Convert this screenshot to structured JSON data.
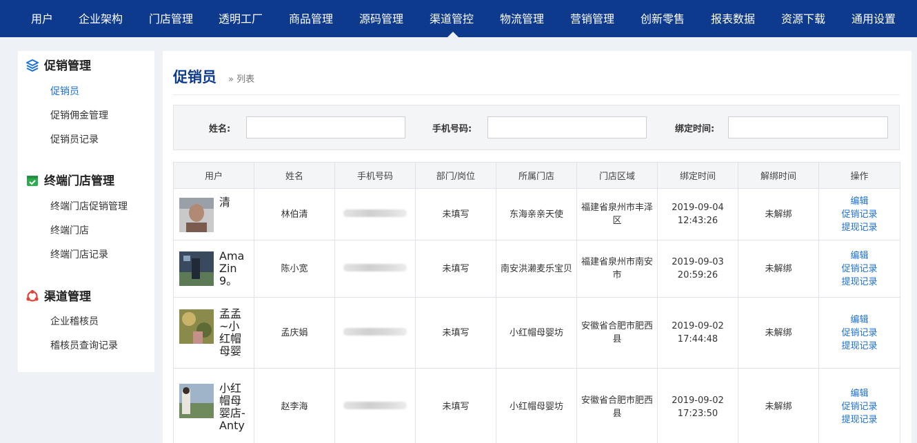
{
  "nav": {
    "items": [
      "用户",
      "企业架构",
      "门店管理",
      "透明工厂",
      "商品管理",
      "源码管理",
      "渠道管控",
      "物流管理",
      "营销管理",
      "创新零售",
      "报表数据",
      "资源下载",
      "通用设置"
    ],
    "active": "渠道管控"
  },
  "sidebar": {
    "sections": [
      {
        "title": "促销管理",
        "icon": "layers-icon",
        "links": [
          "促销员",
          "促销佣金管理",
          "促销员记录"
        ]
      },
      {
        "title": "终端门店管理",
        "icon": "store-icon",
        "links": [
          "终端门店促销管理",
          "终端门店",
          "终端门店记录"
        ]
      },
      {
        "title": "渠道管理",
        "icon": "channel-icon",
        "links": [
          "企业稽核员",
          "稽核员查询记录"
        ]
      }
    ],
    "active_link": "促销员"
  },
  "page": {
    "title": "促销员",
    "crumb": "» 列表"
  },
  "filters": [
    {
      "label": "姓名:",
      "value": ""
    },
    {
      "label": "手机号码:",
      "value": ""
    },
    {
      "label": "绑定时间:",
      "value": ""
    }
  ],
  "table": {
    "headers": [
      "用户",
      "姓名",
      "手机号码",
      "部门/岗位",
      "所属门店",
      "门店区域",
      "绑定时间",
      "解绑时间",
      "操作"
    ],
    "rows": [
      {
        "user": "清",
        "name": "林伯清",
        "dept": "未填写",
        "store": "东海亲亲天使",
        "region": "福建省泉州市丰泽区",
        "bind_time": "2019-09-04 12:43:26",
        "unbind_time": "未解绑"
      },
      {
        "user": "Ama Zin 9。",
        "name": "陈小宽",
        "dept": "未填写",
        "store": "南安洪濑麦乐宝贝",
        "region": "福建省泉州市南安市",
        "bind_time": "2019-09-03 20:59:26",
        "unbind_time": "未解绑"
      },
      {
        "user": "孟孟~小红帽母婴",
        "name": "孟庆娟",
        "dept": "未填写",
        "store": "小红帽母婴坊",
        "region": "安徽省合肥市肥西县",
        "bind_time": "2019-09-02 17:44:48",
        "unbind_time": "未解绑"
      },
      {
        "user": "小红帽母婴店-Anty",
        "name": "赵李海",
        "dept": "未填写",
        "store": "小红帽母婴坊",
        "region": "安徽省合肥市肥西县",
        "bind_time": "2019-09-02 17:23:50",
        "unbind_time": "未解绑"
      }
    ],
    "actions": [
      "编辑",
      "促销记录",
      "提现记录"
    ]
  },
  "colors": {
    "nav_bg": "#0d3a8c",
    "accent": "#1b6fd8",
    "page_bg": "#eef1f5"
  }
}
